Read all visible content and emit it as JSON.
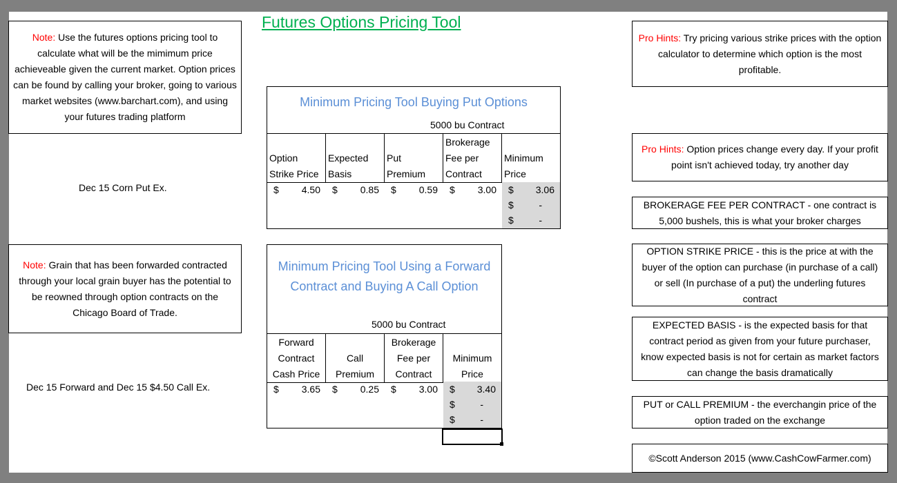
{
  "title": "Futures Options Pricing Tool",
  "notes": {
    "note1": {
      "prefix": "Note:",
      "text": " Use the futures options pricing tool to calculate what will be the mimimum price achieveable given the current market.  Option prices can be found by calling your broker, going to various market websites (www.barchart.com), and using your futures trading platform"
    },
    "note2": {
      "prefix": "Note:",
      "text": " Grain that has been forwarded contracted through your local grain buyer has the potential to be reowned through option contracts on the Chicago Board of Trade."
    }
  },
  "examples": {
    "put_example": "Dec 15 Corn Put Ex.",
    "call_example": "Dec 15 Forward and Dec 15 $4.50 Call Ex."
  },
  "put_tool": {
    "title": "Minimum Pricing Tool Buying Put Options",
    "contract": "5000 bu Contract",
    "headers": [
      [
        "Option",
        "Strike Price"
      ],
      [
        "Expected",
        "Basis"
      ],
      [
        "Put",
        "Premium"
      ],
      [
        "Brokerage",
        "Fee per",
        "Contract"
      ],
      [
        "Minimum",
        "Price"
      ]
    ],
    "currency": "$",
    "values": [
      "4.50",
      "0.85",
      "0.59",
      "3.00",
      "3.06"
    ],
    "extra_min_rows": [
      "-",
      "-"
    ]
  },
  "call_tool": {
    "title_line1": "Minimum Pricing Tool Using a Forward",
    "title_line2": "Contract and Buying A Call Option",
    "contract": "5000 bu Contract",
    "headers": [
      [
        "Forward",
        "Contract",
        "Cash Price"
      ],
      [
        "Call",
        "Premium"
      ],
      [
        "Brokerage",
        "Fee per",
        "Contract"
      ],
      [
        "Minimum",
        "Price"
      ]
    ],
    "currency": "$",
    "values": [
      "3.65",
      "0.25",
      "3.00",
      "3.40"
    ],
    "extra_min_rows": [
      "-",
      "-"
    ]
  },
  "hints": {
    "hint1": {
      "prefix": "Pro Hints:",
      "text": " Try pricing various strike prices with the option calculator to determine which option is the most profitable."
    },
    "hint2": {
      "prefix": "Pro Hints:",
      "text": " Option prices change every day.  If your profit point isn't achieved today, try another day"
    }
  },
  "definitions": {
    "brokerage": "BROKERAGE FEE PER CONTRACT - one contract is 5,000 bushels, this is what your broker charges",
    "strike": "OPTION STRIKE PRICE - this is the price at with the buyer of the option can purchase (in purchase of a call) or sell (In purchase of a put) the underling futures contract",
    "basis": "EXPECTED BASIS - is the expected basis for that contract period as given from your future purchaser, know expected basis is not for certain as market factors can change the basis dramatically",
    "premium": "PUT or CALL PREMIUM - the everchangin price of the option traded on the exchange"
  },
  "copyright": "©Scott Anderson 2015 (www.CashCowFarmer.com)",
  "colors": {
    "title": "#00b050",
    "note_prefix": "#ff0000",
    "tool_title": "#5b8fd6",
    "min_price_fill": "#d9d9d9"
  }
}
